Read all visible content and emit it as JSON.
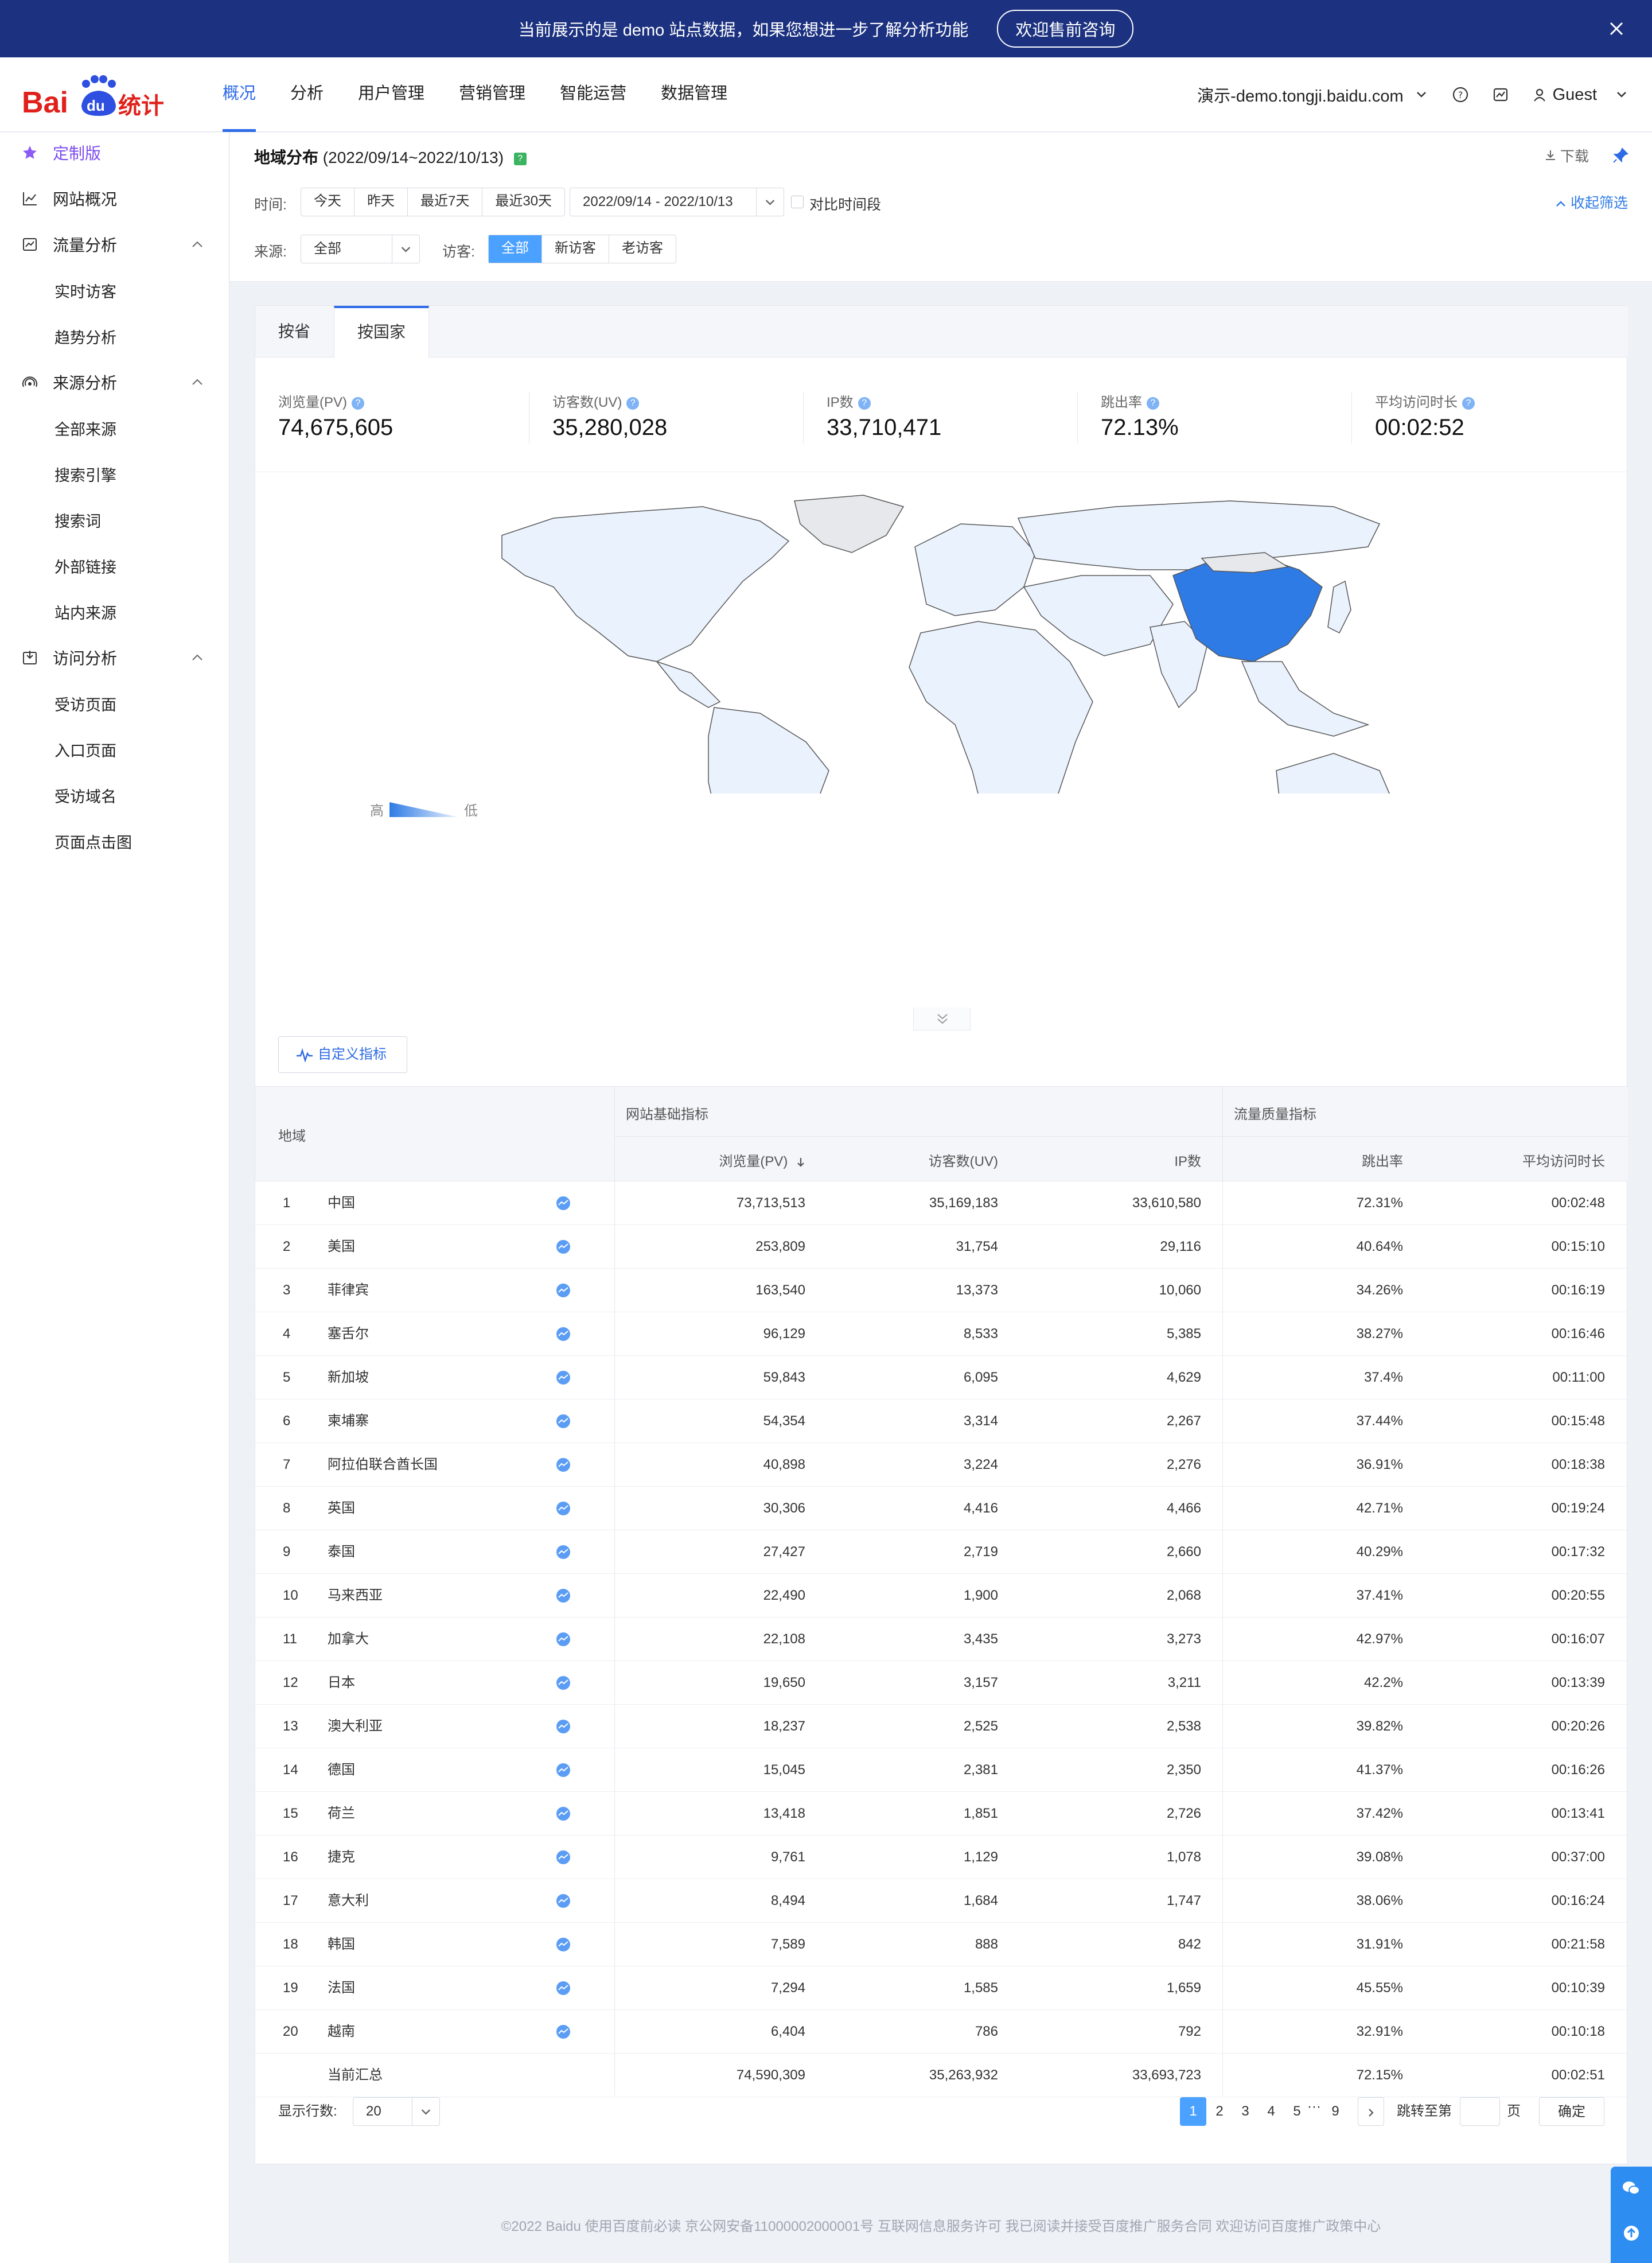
{
  "banner": {
    "message": "当前展示的是 demo 站点数据，如果您想进一步了解分析功能",
    "cta": "欢迎售前咨询"
  },
  "header": {
    "nav": [
      "概况",
      "分析",
      "用户管理",
      "营销管理",
      "智能运营",
      "数据管理"
    ],
    "active_nav": "概况",
    "site": "演示-demo.tongji.baidu.com",
    "user": "Guest"
  },
  "sidebar": {
    "custom": "定制版",
    "overview": "网站概况",
    "groups": [
      {
        "label": "流量分析",
        "items": [
          "实时访客",
          "趋势分析"
        ]
      },
      {
        "label": "来源分析",
        "items": [
          "全部来源",
          "搜索引擎",
          "搜索词",
          "外部链接",
          "站内来源"
        ]
      },
      {
        "label": "访问分析",
        "items": [
          "受访页面",
          "入口页面",
          "受访域名",
          "页面点击图"
        ]
      }
    ]
  },
  "page": {
    "title": "地域分布",
    "range": "(2022/09/14~2022/10/13)",
    "download": "下载",
    "collapse": "收起筛选"
  },
  "filters": {
    "time_label": "时间:",
    "time_options": [
      "今天",
      "昨天",
      "最近7天",
      "最近30天"
    ],
    "date_range": "2022/09/14 - 2022/10/13",
    "compare": "对比时间段",
    "source_label": "来源:",
    "source_value": "全部",
    "visitor_label": "访客:",
    "visitor_options": [
      "全部",
      "新访客",
      "老访客"
    ],
    "visitor_selected": "全部"
  },
  "tabs": [
    "按省",
    "按国家"
  ],
  "active_tab": "按国家",
  "metrics": [
    {
      "label": "浏览量(PV)",
      "value": "74,675,605"
    },
    {
      "label": "访客数(UV)",
      "value": "35,280,028"
    },
    {
      "label": "IP数",
      "value": "33,710,471"
    },
    {
      "label": "跳出率",
      "value": "72.13%"
    },
    {
      "label": "平均访问时长",
      "value": "00:02:52"
    }
  ],
  "map_legend": {
    "high": "高",
    "low": "低"
  },
  "colors": {
    "map_high": "#2e7be6",
    "map_low": "#eaf2fd",
    "accent": "#2e6be6"
  },
  "custom_metrics_button": "自定义指标",
  "table": {
    "region_header": "地域",
    "group_basic": "网站基础指标",
    "group_quality": "流量质量指标",
    "columns": [
      "浏览量(PV)",
      "访客数(UV)",
      "IP数",
      "跳出率",
      "平均访问时长"
    ],
    "rows": [
      {
        "rank": "1",
        "name": "中国",
        "pv": "73,713,513",
        "uv": "35,169,183",
        "ip": "33,610,580",
        "bounce": "72.31%",
        "dur": "00:02:48"
      },
      {
        "rank": "2",
        "name": "美国",
        "pv": "253,809",
        "uv": "31,754",
        "ip": "29,116",
        "bounce": "40.64%",
        "dur": "00:15:10"
      },
      {
        "rank": "3",
        "name": "菲律宾",
        "pv": "163,540",
        "uv": "13,373",
        "ip": "10,060",
        "bounce": "34.26%",
        "dur": "00:16:19"
      },
      {
        "rank": "4",
        "name": "塞舌尔",
        "pv": "96,129",
        "uv": "8,533",
        "ip": "5,385",
        "bounce": "38.27%",
        "dur": "00:16:46"
      },
      {
        "rank": "5",
        "name": "新加坡",
        "pv": "59,843",
        "uv": "6,095",
        "ip": "4,629",
        "bounce": "37.4%",
        "dur": "00:11:00"
      },
      {
        "rank": "6",
        "name": "柬埔寨",
        "pv": "54,354",
        "uv": "3,314",
        "ip": "2,267",
        "bounce": "37.44%",
        "dur": "00:15:48"
      },
      {
        "rank": "7",
        "name": "阿拉伯联合酋长国",
        "pv": "40,898",
        "uv": "3,224",
        "ip": "2,276",
        "bounce": "36.91%",
        "dur": "00:18:38"
      },
      {
        "rank": "8",
        "name": "英国",
        "pv": "30,306",
        "uv": "4,416",
        "ip": "4,466",
        "bounce": "42.71%",
        "dur": "00:19:24"
      },
      {
        "rank": "9",
        "name": "泰国",
        "pv": "27,427",
        "uv": "2,719",
        "ip": "2,660",
        "bounce": "40.29%",
        "dur": "00:17:32"
      },
      {
        "rank": "10",
        "name": "马来西亚",
        "pv": "22,490",
        "uv": "1,900",
        "ip": "2,068",
        "bounce": "37.41%",
        "dur": "00:20:55"
      },
      {
        "rank": "11",
        "name": "加拿大",
        "pv": "22,108",
        "uv": "3,435",
        "ip": "3,273",
        "bounce": "42.97%",
        "dur": "00:16:07"
      },
      {
        "rank": "12",
        "name": "日本",
        "pv": "19,650",
        "uv": "3,157",
        "ip": "3,211",
        "bounce": "42.2%",
        "dur": "00:13:39"
      },
      {
        "rank": "13",
        "name": "澳大利亚",
        "pv": "18,237",
        "uv": "2,525",
        "ip": "2,538",
        "bounce": "39.82%",
        "dur": "00:20:26"
      },
      {
        "rank": "14",
        "name": "德国",
        "pv": "15,045",
        "uv": "2,381",
        "ip": "2,350",
        "bounce": "41.37%",
        "dur": "00:16:26"
      },
      {
        "rank": "15",
        "name": "荷兰",
        "pv": "13,418",
        "uv": "1,851",
        "ip": "2,726",
        "bounce": "37.42%",
        "dur": "00:13:41"
      },
      {
        "rank": "16",
        "name": "捷克",
        "pv": "9,761",
        "uv": "1,129",
        "ip": "1,078",
        "bounce": "39.08%",
        "dur": "00:37:00"
      },
      {
        "rank": "17",
        "name": "意大利",
        "pv": "8,494",
        "uv": "1,684",
        "ip": "1,747",
        "bounce": "38.06%",
        "dur": "00:16:24"
      },
      {
        "rank": "18",
        "name": "韩国",
        "pv": "7,589",
        "uv": "888",
        "ip": "842",
        "bounce": "31.91%",
        "dur": "00:21:58"
      },
      {
        "rank": "19",
        "name": "法国",
        "pv": "7,294",
        "uv": "1,585",
        "ip": "1,659",
        "bounce": "45.55%",
        "dur": "00:10:39"
      },
      {
        "rank": "20",
        "name": "越南",
        "pv": "6,404",
        "uv": "786",
        "ip": "792",
        "bounce": "32.91%",
        "dur": "00:10:18"
      }
    ],
    "summary": {
      "name": "当前汇总",
      "pv": "74,590,309",
      "uv": "35,263,932",
      "ip": "33,693,723",
      "bounce": "72.15%",
      "dur": "00:02:51"
    }
  },
  "pagination": {
    "rows_label": "显示行数:",
    "rows_value": "20",
    "pages": [
      "1",
      "2",
      "3",
      "4",
      "5",
      "9"
    ],
    "current": "1",
    "ellipsis": "···",
    "jump_label": "跳转至第",
    "page_unit": "页",
    "confirm": "确定"
  },
  "footer": "©2022 Baidu 使用百度前必读 京公网安备11000002000001号 互联网信息服务许可 我已阅读并接受百度推广服务合同 欢迎访问百度推广政策中心"
}
